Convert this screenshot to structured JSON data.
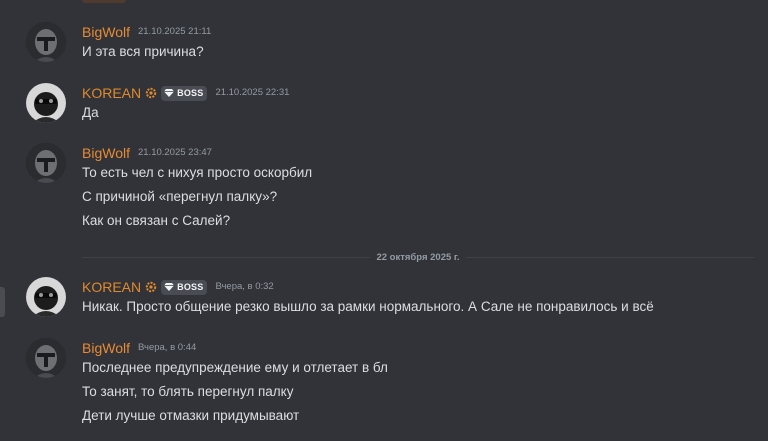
{
  "messages": [
    {
      "author": "BigWolf",
      "timestamp": "21.10.2025 21:11",
      "lines": [
        "И эта вся причина?"
      ]
    },
    {
      "author": "KOREAN",
      "badge": "BOSS",
      "timestamp": "21.10.2025 22:31",
      "lines": [
        "Да"
      ]
    },
    {
      "author": "BigWolf",
      "timestamp": "21.10.2025 23:47",
      "lines": [
        "То есть чел с нихуя просто оскорбил",
        "С причиной «перегнул палку»?",
        "Как он связан с Салей?"
      ]
    },
    {
      "author": "KOREAN",
      "badge": "BOSS",
      "timestamp": "Вчера, в 0:32",
      "lines": [
        "Никак. Просто общение резко вышло за рамки нормального. А Сале не понравилось и всё"
      ]
    },
    {
      "author": "BigWolf",
      "timestamp": "Вчера, в 0:44",
      "lines": [
        "Последнее предупреждение ему и отлетает в бл",
        "То занят, то блять перегнул палку",
        "Дети лучше отмазки придумывают"
      ]
    }
  ],
  "date_divider": "22 октября 2025 г.",
  "icons": {
    "clan_tag": "gear-icon",
    "badge": "gem-icon"
  },
  "colors": {
    "background": "#313338",
    "username": "#e78b34",
    "text": "#dbdee1",
    "muted": "#949ba4"
  }
}
